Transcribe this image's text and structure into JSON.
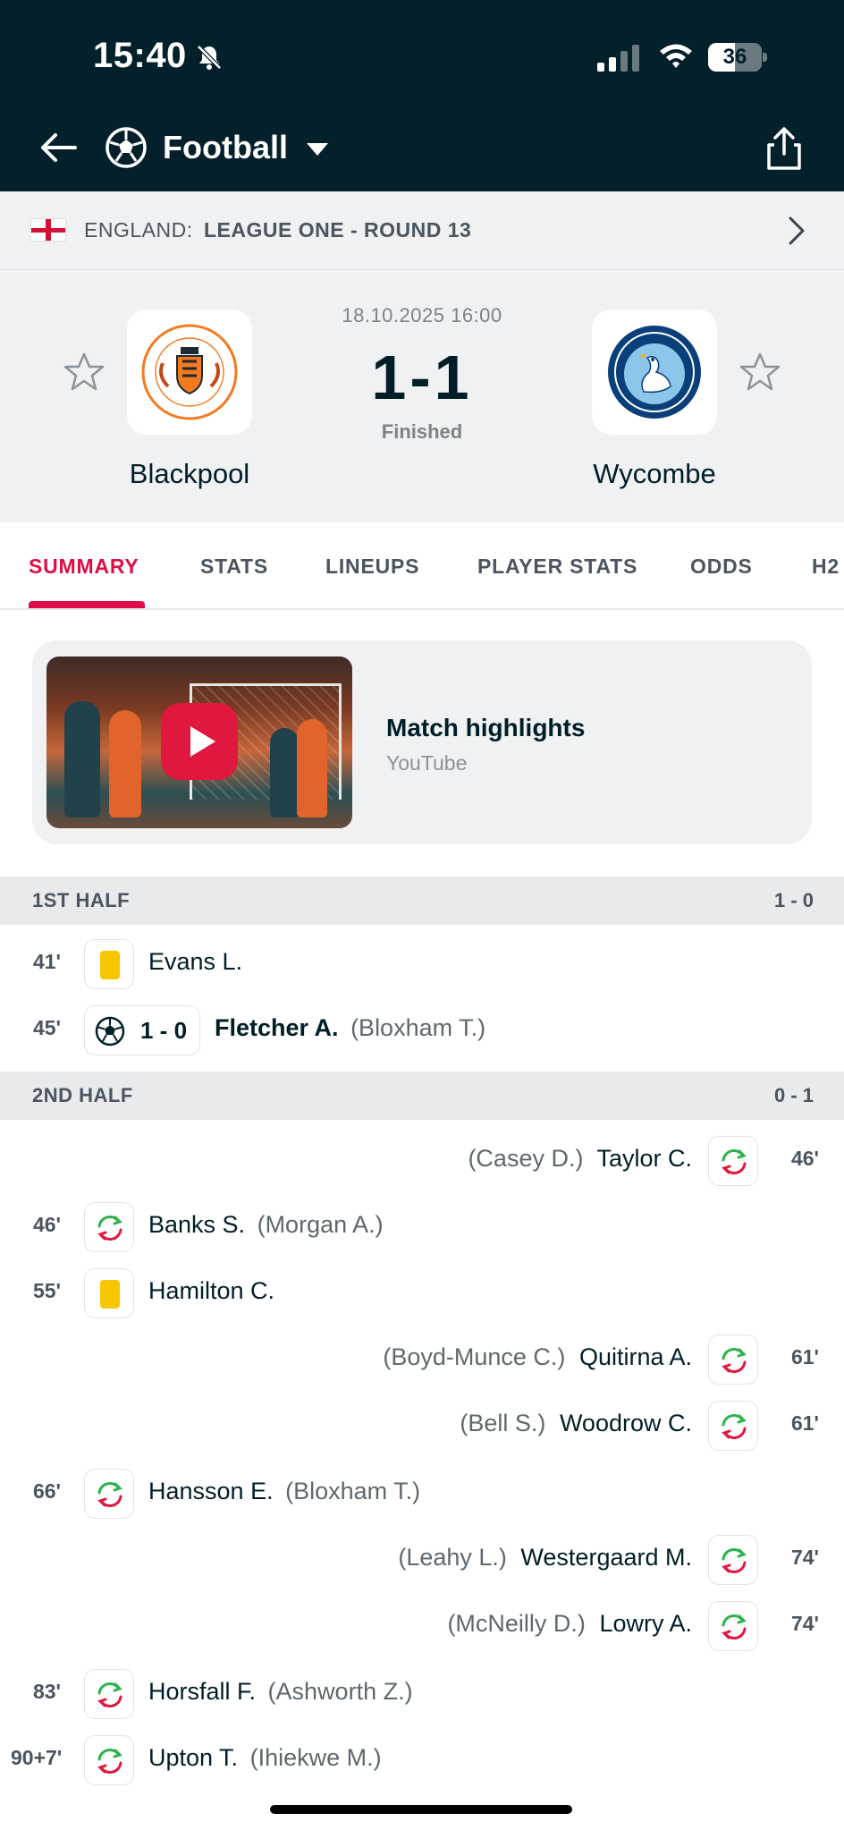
{
  "status_bar": {
    "time": "15:40",
    "battery": "36"
  },
  "header": {
    "sport": "Football"
  },
  "league": {
    "country": "ENGLAND:",
    "name": "LEAGUE ONE - ROUND 13"
  },
  "match": {
    "date": "18.10.2025 16:00",
    "score": "1-1",
    "status": "Finished",
    "home_team": "Blackpool",
    "away_team": "Wycombe"
  },
  "tabs": [
    "SUMMARY",
    "STATS",
    "LINEUPS",
    "PLAYER STATS",
    "ODDS",
    "H2"
  ],
  "highlights": {
    "title": "Match highlights",
    "source": "YouTube"
  },
  "halves": [
    {
      "title": "1ST HALF",
      "score": "1 - 0"
    },
    {
      "title": "2ND HALF",
      "score": "0 - 1"
    }
  ],
  "events": [
    {
      "minute": "41'",
      "player": "Evans L.",
      "assist": ""
    },
    {
      "minute": "45'",
      "goal_score": "1 - 0",
      "player": "Fletcher A.",
      "assist": "(Bloxham T.)"
    },
    {
      "minute": "46'",
      "player": "Taylor C.",
      "assist": "(Casey D.)"
    },
    {
      "minute": "46'",
      "player": "Banks S.",
      "assist": "(Morgan A.)"
    },
    {
      "minute": "55'",
      "player": "Hamilton C.",
      "assist": ""
    },
    {
      "minute": "61'",
      "player": "Quitirna A.",
      "assist": "(Boyd-Munce C.)"
    },
    {
      "minute": "61'",
      "player": "Woodrow C.",
      "assist": "(Bell S.)"
    },
    {
      "minute": "66'",
      "player": "Hansson E.",
      "assist": "(Bloxham T.)"
    },
    {
      "minute": "74'",
      "player": "Westergaard M.",
      "assist": "(Leahy L.)"
    },
    {
      "minute": "74'",
      "player": "Lowry A.",
      "assist": "(McNeilly D.)"
    },
    {
      "minute": "83'",
      "player": "Horsfall F.",
      "assist": "(Ashworth Z.)"
    },
    {
      "minute": "90+7'",
      "player": "Upton T.",
      "assist": "(Ihiekwe M.)"
    }
  ]
}
